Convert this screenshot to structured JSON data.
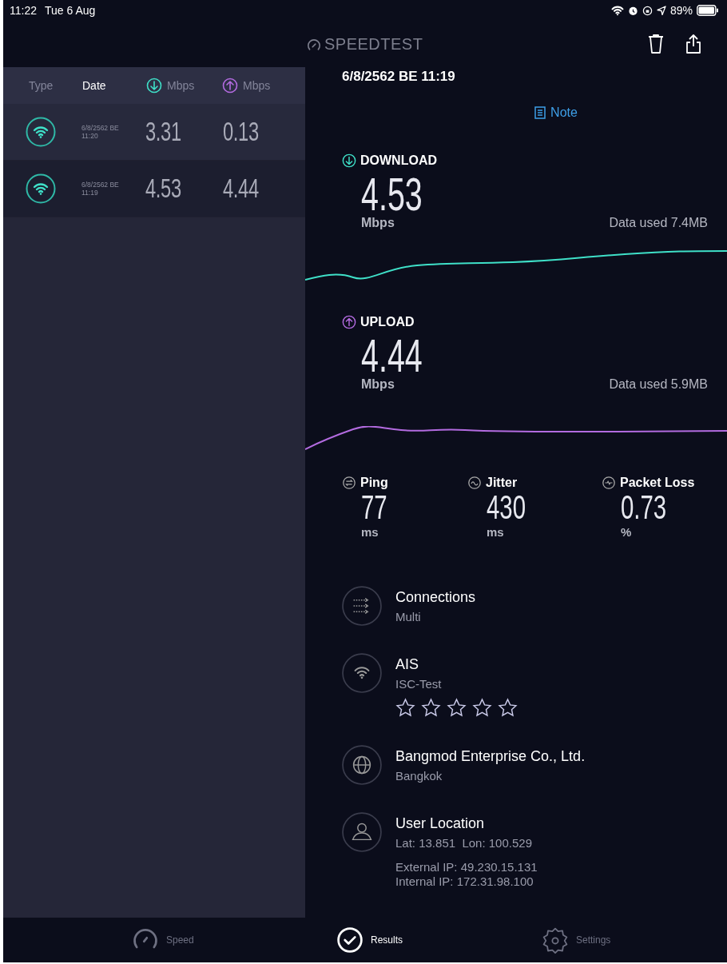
{
  "status_bar": {
    "time": "11:22",
    "date": "Tue 6 Aug",
    "battery": "89%"
  },
  "header": {
    "logo": "SPEEDTEST"
  },
  "history": {
    "columns": [
      {
        "kind": "text",
        "label": "Type",
        "sorted": false
      },
      {
        "kind": "text",
        "label": "Date",
        "sorted": true
      },
      {
        "kind": "download",
        "label": "Mbps",
        "sorted": false
      },
      {
        "kind": "upload",
        "label": "Mbps",
        "sorted": false
      }
    ],
    "rows": [
      {
        "date": "6/8/2562 BE",
        "time": "11:20",
        "download": "3.31",
        "upload": "0.13",
        "selected": false
      },
      {
        "date": "6/8/2562 BE",
        "time": "11:19",
        "download": "4.53",
        "upload": "4.44",
        "selected": true
      }
    ]
  },
  "detail": {
    "datetime": "6/8/2562 BE 11:19",
    "note": "Note",
    "speeds": [
      {
        "kind": "download",
        "label": "DOWNLOAD",
        "value": "4.53",
        "unit": "Mbps",
        "data_used": "Data used 7.4MB"
      },
      {
        "kind": "upload",
        "label": "UPLOAD",
        "value": "4.44",
        "unit": "Mbps",
        "data_used": "Data used 5.9MB"
      }
    ],
    "metrics": [
      {
        "kind": "ping",
        "label": "Ping",
        "value": "77",
        "unit": "ms"
      },
      {
        "kind": "jitter",
        "label": "Jitter",
        "value": "430",
        "unit": "ms"
      },
      {
        "kind": "loss",
        "label": "Packet Loss",
        "value": "0.73",
        "unit": "%"
      }
    ],
    "info": [
      {
        "kind": "connections",
        "title": "Connections",
        "lines": [
          "Multi"
        ]
      },
      {
        "kind": "network",
        "title": "AIS",
        "lines": [
          "ISC-Test"
        ],
        "stars": 0
      },
      {
        "kind": "server",
        "title": "Bangmod Enterprise Co., Ltd.",
        "lines": [
          "Bangkok"
        ]
      },
      {
        "kind": "location",
        "title": "User Location",
        "lines": [
          "Lat: 13.851  Lon: 100.529"
        ],
        "extra": [
          "External IP: 49.230.15.131",
          "Internal IP: 172.31.98.100"
        ]
      }
    ]
  },
  "tabbar": {
    "tabs": [
      {
        "kind": "speed",
        "label": "Speed",
        "selected": false
      },
      {
        "kind": "results",
        "label": "Results",
        "selected": true
      },
      {
        "kind": "settings",
        "label": "Settings",
        "selected": false
      }
    ]
  }
}
